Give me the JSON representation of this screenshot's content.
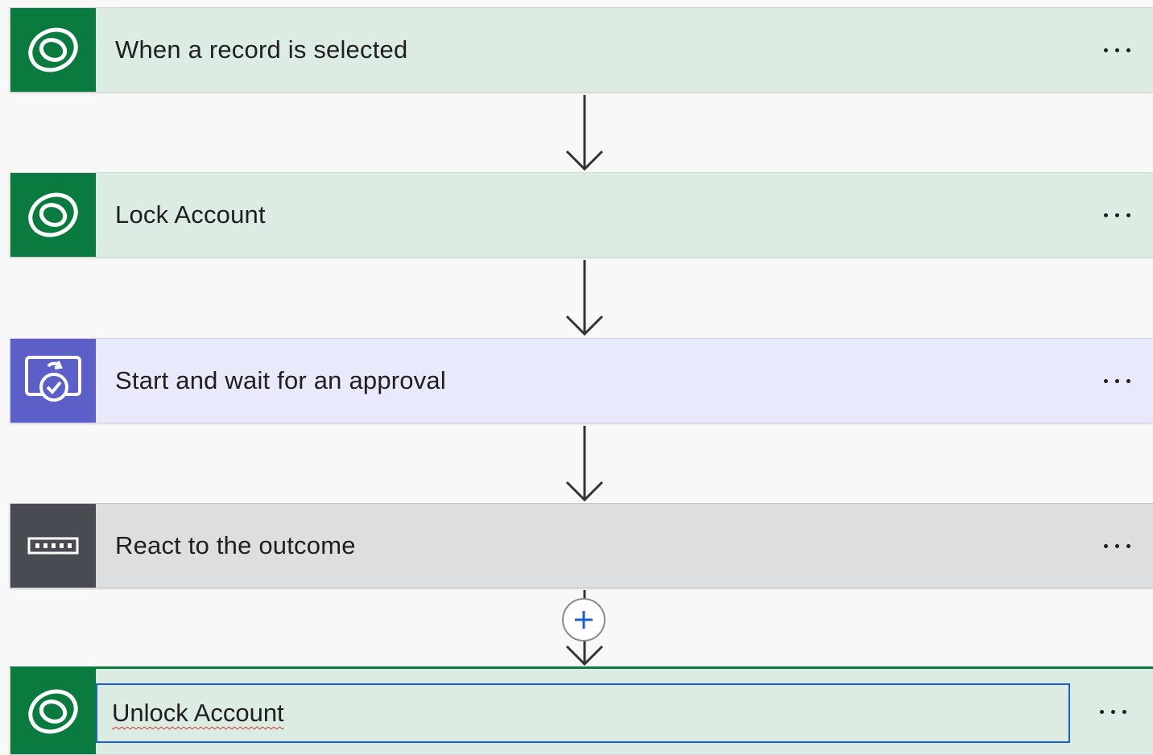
{
  "steps": [
    {
      "title": "When a record is selected",
      "icon": "dataverse-icon",
      "accent": "#0b7a3e"
    },
    {
      "title": "Lock Account",
      "icon": "dataverse-icon",
      "accent": "#0b7a3e"
    },
    {
      "title": "Start and wait for an approval",
      "icon": "approval-icon",
      "accent": "#5b5fc7"
    },
    {
      "title": "React to the outcome",
      "icon": "condition-icon",
      "accent": "#484b52"
    },
    {
      "title": "Unlock Account",
      "icon": "dataverse-icon",
      "accent": "#0b7a3e",
      "editing": true
    }
  ],
  "more_menu_icon": "ellipsis-icon",
  "add_step_icon": "plus-icon",
  "colors": {
    "dataverse": "#0b7a3e",
    "approval": "#5b5fc7",
    "condition": "#484b52",
    "focus_border": "#1a5fd6",
    "spellcheck": "#d13438"
  }
}
